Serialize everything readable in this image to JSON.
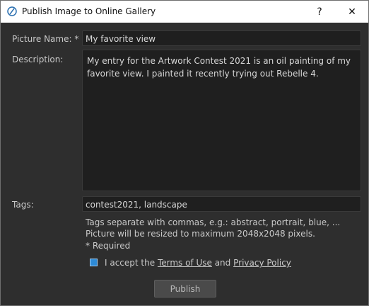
{
  "window": {
    "title": "Publish Image to Online Gallery",
    "help_glyph": "?",
    "close_glyph": "✕"
  },
  "form": {
    "picture_name_label": "Picture Name: *",
    "picture_name_value": "My favorite view",
    "description_label": "Description:",
    "description_value": "My entry for the Artwork Contest 2021 is an oil painting of my favorite view. I painted it recently trying out Rebelle 4.",
    "tags_label": "Tags:",
    "tags_value": "contest2021, landscape"
  },
  "hints": {
    "tags_hint": "Tags separate with commas, e.g.: abstract, portrait, blue, ...",
    "resize_hint": "Picture will be resized to maximum 2048x2048 pixels.",
    "required_hint": "* Required"
  },
  "consent": {
    "checked": true,
    "prefix": "I accept the ",
    "terms_link": "Terms of Use",
    "and": " and ",
    "privacy_link": "Privacy Policy"
  },
  "actions": {
    "publish_label": "Publish"
  },
  "colors": {
    "background": "#2e2e2e",
    "field": "#1f1f1f",
    "checkbox_accent": "#2d8ad6"
  }
}
